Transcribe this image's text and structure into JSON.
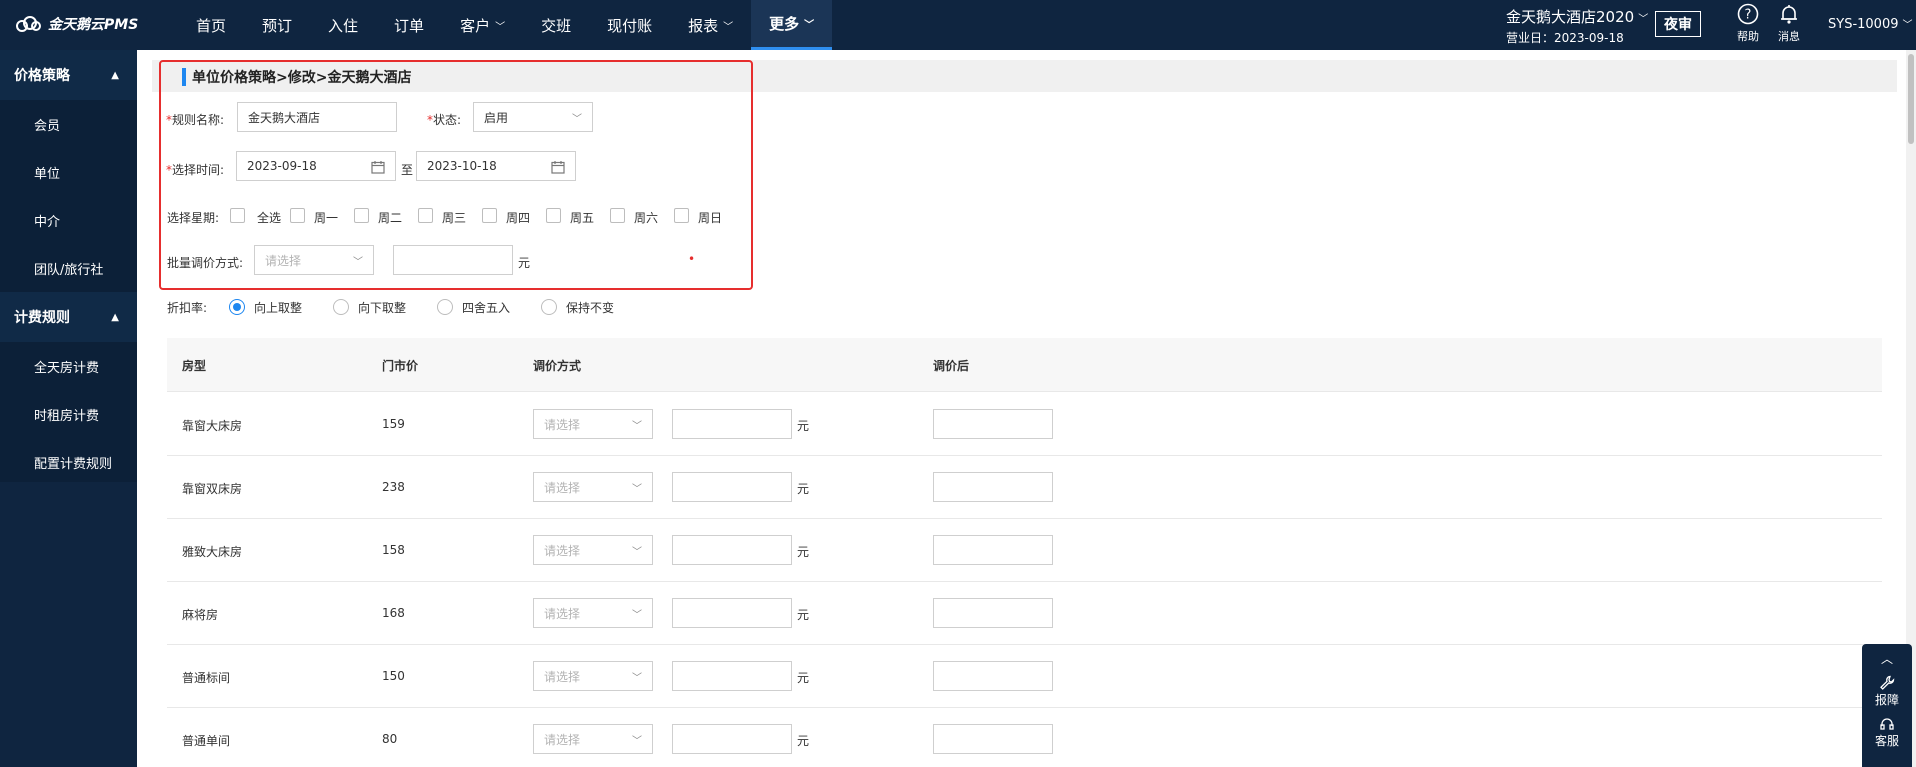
{
  "app": {
    "logo_text": "金天鹅云PMS"
  },
  "nav": {
    "items": [
      {
        "label": "首页",
        "has_chevron": false,
        "active": false
      },
      {
        "label": "预订",
        "has_chevron": false,
        "active": false
      },
      {
        "label": "入住",
        "has_chevron": false,
        "active": false
      },
      {
        "label": "订单",
        "has_chevron": false,
        "active": false
      },
      {
        "label": "客户",
        "has_chevron": true,
        "active": false
      },
      {
        "label": "交班",
        "has_chevron": false,
        "active": false
      },
      {
        "label": "现付账",
        "has_chevron": false,
        "active": false
      },
      {
        "label": "报表",
        "has_chevron": true,
        "active": false
      },
      {
        "label": "更多",
        "has_chevron": true,
        "active": true
      }
    ]
  },
  "header": {
    "hotel_name": "金天鹅大酒店2020",
    "business_date": "营业日：2023-09-18",
    "night_audit": "夜审",
    "help": "帮助",
    "messages": "消息",
    "user": "SYS-10009"
  },
  "sidebar": {
    "groups": [
      {
        "label": "价格策略",
        "items": [
          "会员",
          "单位",
          "中介",
          "团队/旅行社"
        ]
      },
      {
        "label": "计费规则",
        "items": [
          "全天房计费",
          "时租房计费",
          "配置计费规则"
        ]
      }
    ]
  },
  "page": {
    "breadcrumb_title": "单位价格策略>修改>金天鹅大酒店",
    "rule_name_label": "规则名称:",
    "rule_name_value": "金天鹅大酒店",
    "status_label": "状态:",
    "status_value": "启用",
    "time_label": "选择时间:",
    "date_from": "2023-09-18",
    "date_to_sep": "至",
    "date_to": "2023-10-18",
    "week_label": "选择星期:",
    "week_options": [
      "全选",
      "周一",
      "周二",
      "周三",
      "周四",
      "周五",
      "周六",
      "周日"
    ],
    "batch_label": "批量调价方式:",
    "batch_placeholder": "请选择",
    "batch_unit": "元",
    "discount_label": "折扣率:",
    "rounding_options": [
      "向上取整",
      "向下取整",
      "四舍五入",
      "保持不变"
    ],
    "rounding_selected": 0
  },
  "table": {
    "headers": [
      "房型",
      "门市价",
      "调价方式",
      "调价后"
    ],
    "select_placeholder": "请选择",
    "unit": "元",
    "rows": [
      {
        "room_type": "靠窗大床房",
        "rack_price": "159"
      },
      {
        "room_type": "靠窗双床房",
        "rack_price": "238"
      },
      {
        "room_type": "雅致大床房",
        "rack_price": "158"
      },
      {
        "room_type": "麻将房",
        "rack_price": "168"
      },
      {
        "room_type": "普通标间",
        "rack_price": "150"
      },
      {
        "room_type": "普通单间",
        "rack_price": "80"
      }
    ]
  },
  "float_tools": {
    "repair": "报障",
    "service": "客服"
  },
  "colors": {
    "nav_bg": "#0f2540",
    "accent": "#1e87f0",
    "highlight": "#e62e2e"
  }
}
